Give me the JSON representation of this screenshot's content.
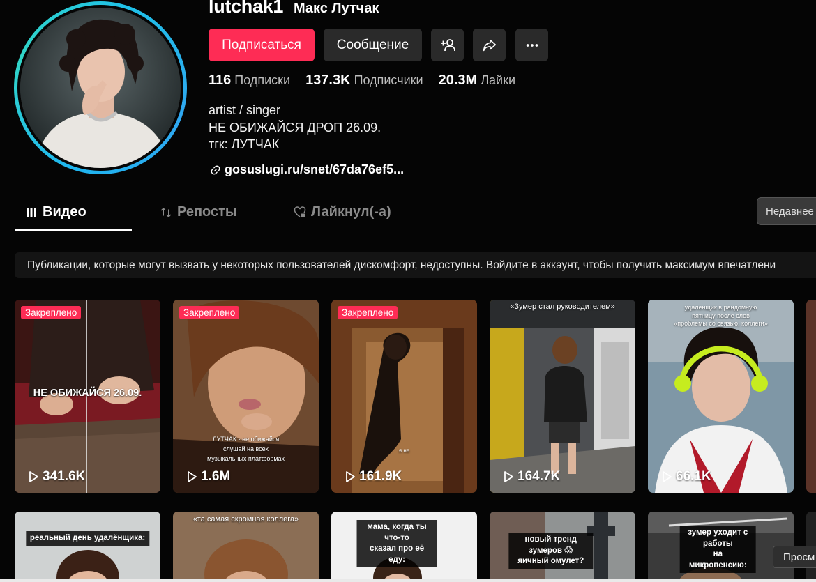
{
  "profile": {
    "username": "lutchak1",
    "nickname": "Макс Лутчак",
    "follow_label": "Подписаться",
    "message_label": "Сообщение",
    "stats": [
      {
        "value": "116",
        "label": "Подписки"
      },
      {
        "value": "137.3K",
        "label": "Подписчики"
      },
      {
        "value": "20.3M",
        "label": "Лайки"
      }
    ],
    "bio": [
      "artist / singer",
      "НЕ ОБИЖАЙСЯ ДРОП 26.09.",
      "тгк: ЛУТЧАК"
    ],
    "link": "gosuslugi.ru/snet/67da76ef5..."
  },
  "tabs": {
    "video": "Видео",
    "reposts": "Репосты",
    "liked": "Лайкнул(-а)",
    "sort": "Недавнее"
  },
  "notice": "Публикации, которые могут вызвать у некоторых пользователей дискомфорт, недоступны. Войдите в аккаунт, чтобы получить максимум впечатлени",
  "videos": [
    {
      "pinned": "Закреплено",
      "views": "341.6K",
      "overlay": "НЕ ОБИЖАЙСЯ 26.09."
    },
    {
      "pinned": "Закреплено",
      "views": "1.6M",
      "overlay": "ЛУТЧАК - не обижайся\nслушай на всех\nмузыкальных платформах"
    },
    {
      "pinned": "Закреплено",
      "views": "161.9K",
      "overlay": "я не"
    },
    {
      "views": "164.7K",
      "overlay": "«Зумер стал руководителем»"
    },
    {
      "views": "66.1K",
      "overlay": "удаленщик в рандомную\nпятницу после слов\n«проблемы со связью, коллеги»"
    },
    {
      "overlay": "реальный день удалёнщика:"
    },
    {
      "overlay": "«та самая скромная коллега»"
    },
    {
      "overlay": "мама, когда ты что-то\nсказал про её еду:"
    },
    {
      "overlay": "новый тренд зумеров 😱\nяичный омулет?"
    },
    {
      "overlay": "зумер уходит с работы\nна микропенсию:"
    }
  ],
  "tooltip": "Просм",
  "colors": {
    "accent": "#fe2c55",
    "background": "#050505",
    "avatar_ring": "#1fb6f0"
  }
}
